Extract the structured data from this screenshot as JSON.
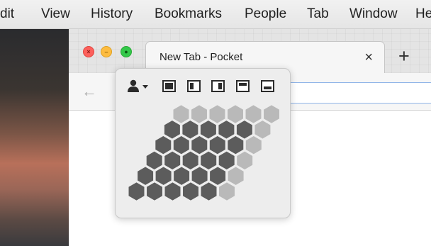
{
  "menubar": {
    "items": [
      "dit",
      "View",
      "History",
      "Bookmarks",
      "People",
      "Tab",
      "Window",
      "He"
    ]
  },
  "window": {
    "tab": {
      "title": "New Tab - Pocket",
      "close": "×"
    },
    "new_tab": "+",
    "back": "←"
  },
  "popup": {
    "person_icon": "person-with-dropdown-icon",
    "layout_buttons": [
      "layout-full-icon",
      "layout-left-half-icon",
      "layout-right-half-icon",
      "layout-top-half-icon",
      "layout-bottom-half-icon"
    ],
    "hex_grid": {
      "rows": 6,
      "columns": 6,
      "selected_rows": 5,
      "selected_columns": 5
    },
    "colors": {
      "selected": "#5c5c5c",
      "unselected": "#b9b9b9",
      "background": "#ededed"
    }
  }
}
